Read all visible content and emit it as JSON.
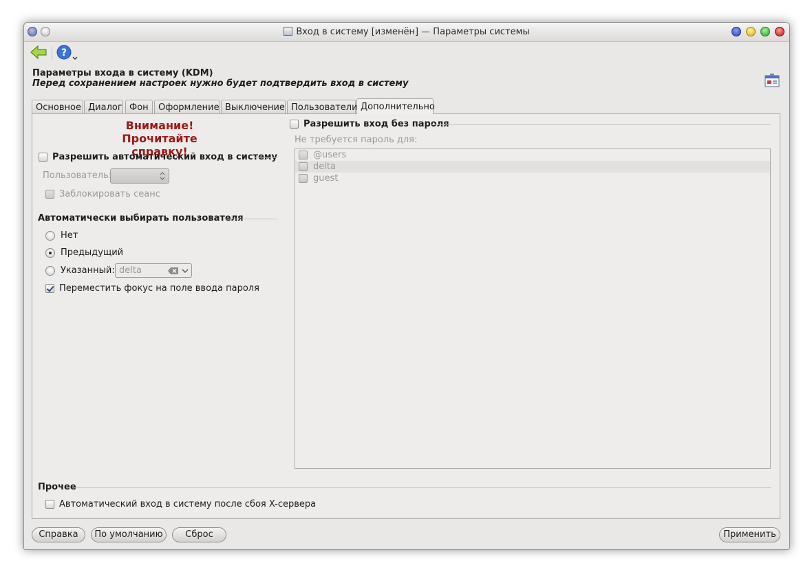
{
  "window": {
    "title": "Вход в систему [изменён] — Параметры системы",
    "control_colors": [
      "#3a4fc0",
      "#e8c020",
      "#3cb43c",
      "#d01a1a"
    ]
  },
  "toolbar": {
    "back_icon": "arrow-left-icon",
    "help_icon": "help-icon"
  },
  "header": {
    "title": "Параметры входа в систему (KDM)",
    "subtitle": "Перед сохранением настроек нужно будет подтвердить вход в систему"
  },
  "tabs": [
    {
      "label": "Основное",
      "active": false
    },
    {
      "label": "Диалог",
      "active": false
    },
    {
      "label": "Фон",
      "active": false
    },
    {
      "label": "Оформление",
      "active": false
    },
    {
      "label": "Выключение",
      "active": false
    },
    {
      "label": "Пользователи",
      "active": false
    },
    {
      "label": "Дополнительно",
      "active": true
    }
  ],
  "left": {
    "warning_line1": "Внимание!",
    "warning_line2": "Прочитайте справку!",
    "autologin_label": "Разрешить автоматический вход в систему",
    "user_label": "Пользователь:",
    "lock_session_label": "Заблокировать сеанс",
    "autoselect_heading": "Автоматически выбирать пользователя",
    "radio_none": "Нет",
    "radio_previous": "Предыдущий",
    "radio_specified": "Указанный:",
    "specified_value": "delta",
    "focus_password_label": "Переместить фокус на поле ввода пароля",
    "focus_password_checked": true,
    "selected_radio": "previous"
  },
  "right": {
    "nopass_label": "Разрешить вход без пароля",
    "nopass_sublabel": "Не требуется пароль для:",
    "users": [
      "@users",
      "delta",
      "guest"
    ]
  },
  "other": {
    "heading": "Прочее",
    "xcrash_label": "Автоматический вход в систему после сбоя X-сервера"
  },
  "buttons": {
    "help": "Справка",
    "defaults": "По умолчанию",
    "reset": "Сброс",
    "apply": "Применить"
  }
}
